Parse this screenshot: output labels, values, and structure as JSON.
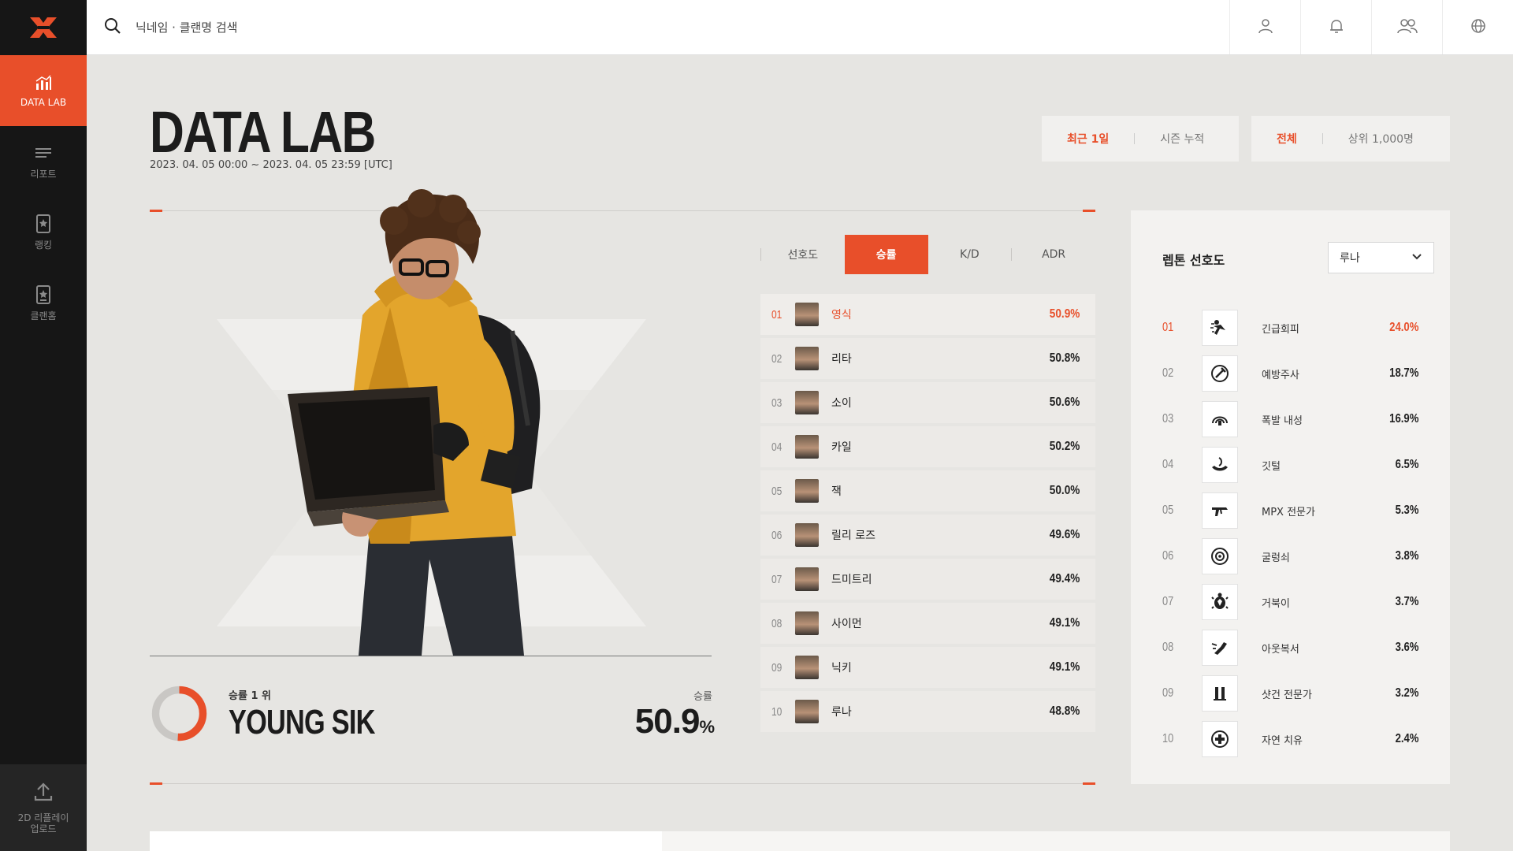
{
  "sidebar": {
    "items": [
      {
        "label": "DATA LAB",
        "icon": "chart-icon",
        "active": true
      },
      {
        "label": "리포트",
        "icon": "report-icon",
        "active": false
      },
      {
        "label": "랭킹",
        "icon": "ranking-icon",
        "active": false
      },
      {
        "label": "클랜홈",
        "icon": "clan-icon",
        "active": false
      }
    ],
    "upload_label_line1": "2D 리플레이",
    "upload_label_line2": "업로드"
  },
  "search": {
    "placeholder": "닉네임 · 클랜명 검색"
  },
  "page": {
    "title": "DATA LAB",
    "date_range": "2023. 04. 05 00:00 ~ 2023. 04. 05 23:59 [UTC]"
  },
  "filters": {
    "period": [
      {
        "label": "최근 1일",
        "selected": true
      },
      {
        "label": "시즌 누적",
        "selected": false
      }
    ],
    "scope": [
      {
        "label": "전체",
        "selected": true
      },
      {
        "label": "상위 1,000명",
        "selected": false
      }
    ]
  },
  "highlight": {
    "subtitle": "승률 1 위",
    "name": "YOUNG SIK",
    "rate_label": "승률",
    "rate_value": "50.9",
    "rate_unit": "%",
    "donut_fraction": 0.509
  },
  "tabs": [
    {
      "label": "선호도",
      "active": false
    },
    {
      "label": "승률",
      "active": true
    },
    {
      "label": "K/D",
      "active": false
    },
    {
      "label": "ADR",
      "active": false
    }
  ],
  "ranking": [
    {
      "rank": "01",
      "name": "영식",
      "value": "50.9%"
    },
    {
      "rank": "02",
      "name": "리타",
      "value": "50.8%"
    },
    {
      "rank": "03",
      "name": "소이",
      "value": "50.6%"
    },
    {
      "rank": "04",
      "name": "카일",
      "value": "50.2%"
    },
    {
      "rank": "05",
      "name": "잭",
      "value": "50.0%"
    },
    {
      "rank": "06",
      "name": "릴리 로즈",
      "value": "49.6%"
    },
    {
      "rank": "07",
      "name": "드미트리",
      "value": "49.4%"
    },
    {
      "rank": "08",
      "name": "사이먼",
      "value": "49.1%"
    },
    {
      "rank": "09",
      "name": "닉키",
      "value": "49.1%"
    },
    {
      "rank": "10",
      "name": "루나",
      "value": "48.8%"
    }
  ],
  "perks": {
    "title": "렙톤 선호도",
    "selected_character": "루나",
    "items": [
      {
        "rank": "01",
        "name": "긴급회피",
        "value": "24.0%",
        "icon": "dodge-icon"
      },
      {
        "rank": "02",
        "name": "예방주사",
        "value": "18.7%",
        "icon": "vaccine-icon"
      },
      {
        "rank": "03",
        "name": "폭발 내성",
        "value": "16.9%",
        "icon": "blast-resist-icon"
      },
      {
        "rank": "04",
        "name": "깃털",
        "value": "6.5%",
        "icon": "feather-icon"
      },
      {
        "rank": "05",
        "name": "MPX 전문가",
        "value": "5.3%",
        "icon": "smg-icon"
      },
      {
        "rank": "06",
        "name": "굴렁쇠",
        "value": "3.8%",
        "icon": "hoop-icon"
      },
      {
        "rank": "07",
        "name": "거북이",
        "value": "3.7%",
        "icon": "turtle-icon"
      },
      {
        "rank": "08",
        "name": "아웃복서",
        "value": "3.6%",
        "icon": "boxer-icon"
      },
      {
        "rank": "09",
        "name": "샷건 전문가",
        "value": "3.2%",
        "icon": "shotgun-icon"
      },
      {
        "rank": "10",
        "name": "자연 치유",
        "value": "2.4%",
        "icon": "heal-icon"
      }
    ]
  },
  "colors": {
    "accent": "#e84f2a",
    "sidebar": "#161616",
    "background": "#e6e5e2"
  }
}
